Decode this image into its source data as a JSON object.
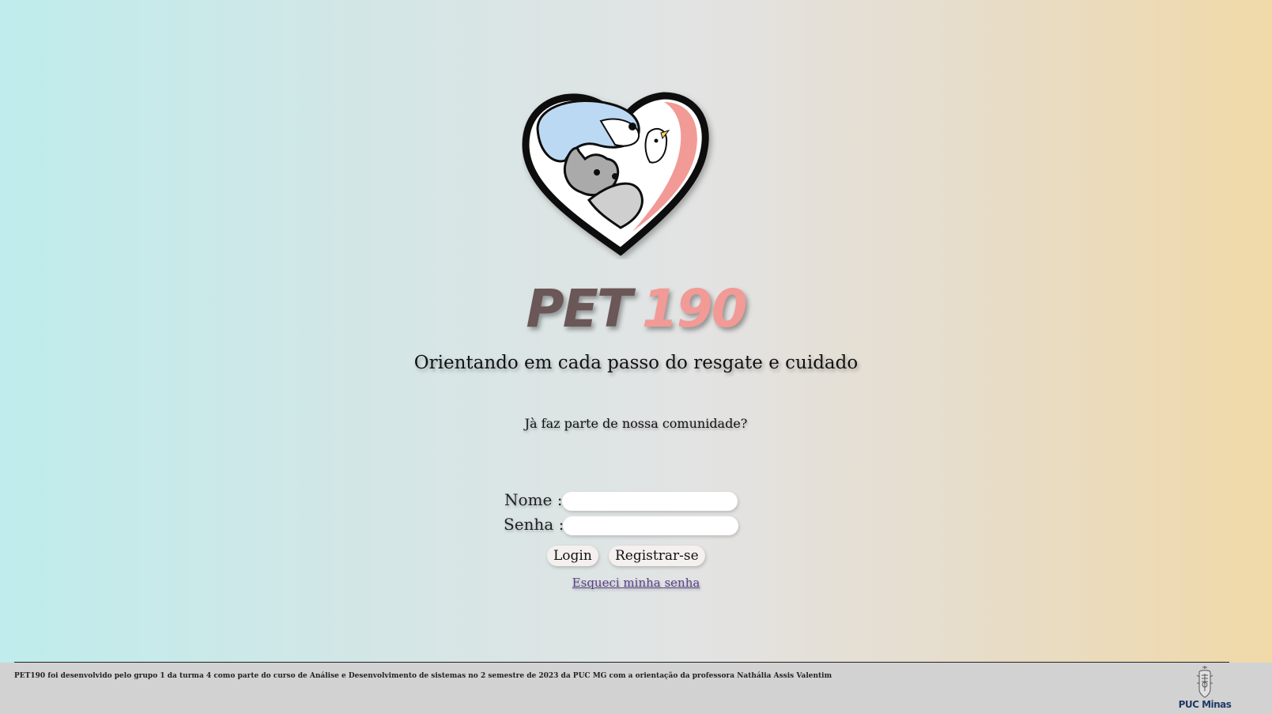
{
  "brand": {
    "part1": "PET",
    "part2": "190"
  },
  "tagline": "Orientando em cada passo do resgate e cuidado",
  "community_question": "Jà faz parte de nossa comunidade?",
  "form": {
    "name_label": "Nome :",
    "password_label": "Senha :",
    "name_value": "",
    "password_value": "",
    "login_button": "Login",
    "register_button": "Registrar-se",
    "forgot_link": "Esqueci minha senha"
  },
  "footer": {
    "text": "PET190 foi desenvolvido pelo grupo 1 da turma 4 como parte do curso de Análise e Desenvolvimento de sistemas no 2 semestre de 2023 da PUC MG com a orientação da professora Nathália Assis Valentim",
    "university_logo_text": "PUC Minas"
  },
  "icons": {
    "main_logo": "heart-pets-logo-icon",
    "university": "puc-crest-icon"
  }
}
